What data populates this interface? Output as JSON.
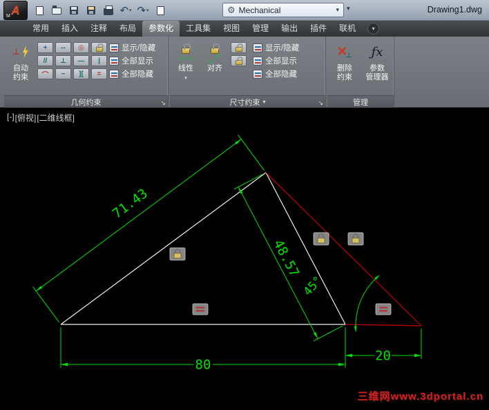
{
  "titlebar": {
    "logo_letter": "A",
    "logo_sub": "M",
    "workspace": "Mechanical",
    "title": "Drawing1.dwg"
  },
  "icons": {
    "dropdown": "▾",
    "launcher": "↘",
    "gear": "⚙",
    "undo": "↶",
    "redo": "↷",
    "ribbon_toggle": "▾",
    "delete_x": "×",
    "delete_sub": "⊥",
    "auto_mark": "⊥",
    "fx": "ƒx"
  },
  "tabs": [
    {
      "label": "常用"
    },
    {
      "label": "插入"
    },
    {
      "label": "注释"
    },
    {
      "label": "布局"
    },
    {
      "label": "参数化"
    },
    {
      "label": "工具集"
    },
    {
      "label": "视图"
    },
    {
      "label": "管理"
    },
    {
      "label": "输出"
    },
    {
      "label": "插件"
    },
    {
      "label": "联机"
    }
  ],
  "ribbon": {
    "geometric": {
      "title": "几何约束",
      "auto_line1": "自动",
      "auto_line2": "约束",
      "grid": [
        {
          "name": "coincident",
          "glyph": "+"
        },
        {
          "name": "collinear",
          "glyph": "--"
        },
        {
          "name": "concentric",
          "glyph": "◎"
        },
        {
          "name": "fix",
          "glyph": ""
        },
        {
          "name": "parallel",
          "glyph": "//"
        },
        {
          "name": "perpendicular",
          "glyph": "⊥"
        },
        {
          "name": "horizontal",
          "glyph": "—"
        },
        {
          "name": "vertical",
          "glyph": "|"
        },
        {
          "name": "tangent",
          "glyph": "⌒"
        },
        {
          "name": "smooth",
          "glyph": "~"
        },
        {
          "name": "symmetric",
          "glyph": "]["
        },
        {
          "name": "equal",
          "glyph": "="
        }
      ],
      "show_hide": "显示/隐藏",
      "show_all": "全部显示",
      "hide_all": "全部隐藏"
    },
    "dimensional": {
      "title": "尺寸约束",
      "linear": "线性",
      "aligned": "对齐",
      "show_hide": "显示/隐藏",
      "show_all": "全部显示",
      "hide_all": "全部隐藏"
    },
    "manage": {
      "title": "管理",
      "delete_line1": "删除",
      "delete_line2": "约束",
      "params_line1": "参数",
      "params_line2": "管理器"
    }
  },
  "canvas": {
    "viewport_controls": {
      "minus": "[-]",
      "view": "[俯视]",
      "style": "[二维线框]"
    },
    "dimensions": {
      "left_slope": "71.43",
      "inner_slope": "48.57",
      "angle": "45°",
      "base": "80",
      "extension": "20"
    },
    "colors": {
      "dimension_green": "#00e100",
      "geometry_white": "#f0f0f0",
      "construction_red": "#c40000",
      "badge_gray": "#909090"
    },
    "watermark": "三维网www.3dportal.cn"
  }
}
